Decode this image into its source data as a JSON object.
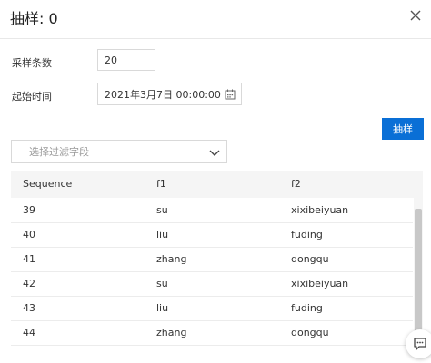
{
  "dialog": {
    "title": "抽样: 0"
  },
  "form": {
    "sample_count_label": "采样条数",
    "sample_count_value": "20",
    "start_time_label": "起始时间",
    "start_time_value": "2021年3月7日 00:00:00",
    "sample_button_label": "抽样",
    "filter_placeholder": "选择过滤字段"
  },
  "table": {
    "columns": [
      "Sequence",
      "f1",
      "f2"
    ],
    "rows": [
      [
        "39",
        "su",
        "xixibeiyuan"
      ],
      [
        "40",
        "liu",
        "fuding"
      ],
      [
        "41",
        "zhang",
        "dongqu"
      ],
      [
        "42",
        "su",
        "xixibeiyuan"
      ],
      [
        "43",
        "liu",
        "fuding"
      ],
      [
        "44",
        "zhang",
        "dongqu"
      ]
    ]
  },
  "icons": {
    "close": "close-icon",
    "calendar": "calendar-icon",
    "dropdown": "chevron-down-icon",
    "chat": "chat-icon"
  }
}
